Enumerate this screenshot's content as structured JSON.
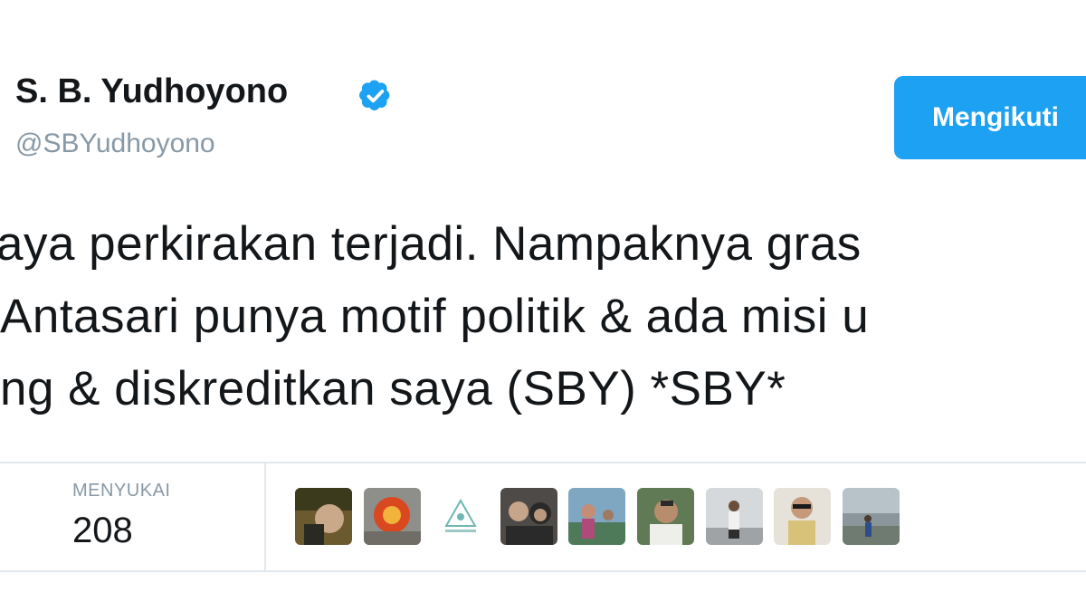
{
  "author": {
    "name": "S. B. Yudhoyono",
    "handle": "@SBYudhoyono",
    "verified_icon": "verified-badge-icon",
    "accent_color": "#1da1f2"
  },
  "follow_button": {
    "label": "Mengikuti"
  },
  "tweet": {
    "lines": [
      "aya perkirakan terjadi. Nampaknya gras",
      "Antasari punya motif politik & ada misi u",
      "ng & diskreditkan saya (SBY) *SBY*"
    ]
  },
  "stats": {
    "likes_label": "MENYUKAI",
    "likes_count": "208"
  },
  "likers": [
    {
      "icon": "user-avatar-1"
    },
    {
      "icon": "user-avatar-2"
    },
    {
      "icon": "user-avatar-3"
    },
    {
      "icon": "user-avatar-4"
    },
    {
      "icon": "user-avatar-5"
    },
    {
      "icon": "user-avatar-6"
    },
    {
      "icon": "user-avatar-7"
    },
    {
      "icon": "user-avatar-8"
    },
    {
      "icon": "user-avatar-9"
    }
  ]
}
